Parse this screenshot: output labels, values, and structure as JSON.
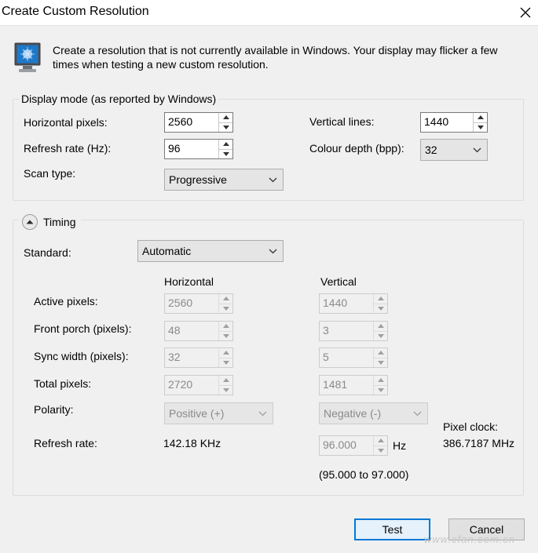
{
  "window": {
    "title": "Create Custom Resolution"
  },
  "intro": {
    "text": "Create a resolution that is not currently available in Windows. Your display may flicker a few times when testing a new custom resolution."
  },
  "display_mode": {
    "group_label": "Display mode (as reported by Windows)",
    "horizontal_pixels": {
      "label": "Horizontal pixels:",
      "value": "2560"
    },
    "vertical_lines": {
      "label": "Vertical lines:",
      "value": "1440"
    },
    "refresh_rate": {
      "label": "Refresh rate (Hz):",
      "value": "96"
    },
    "colour_depth": {
      "label": "Colour depth (bpp):",
      "value": "32"
    },
    "scan_type": {
      "label": "Scan type:",
      "value": "Progressive"
    }
  },
  "timing": {
    "label": "Timing",
    "standard": {
      "label": "Standard:",
      "value": "Automatic"
    },
    "col_horizontal": "Horizontal",
    "col_vertical": "Vertical",
    "rows": [
      {
        "label": "Active pixels:",
        "h": "2560",
        "v": "1440"
      },
      {
        "label": "Front porch (pixels):",
        "h": "48",
        "v": "3"
      },
      {
        "label": "Sync width (pixels):",
        "h": "32",
        "v": "5"
      },
      {
        "label": "Total pixels:",
        "h": "2720",
        "v": "1481"
      }
    ],
    "polarity": {
      "label": "Polarity:",
      "h": "Positive (+)",
      "v": "Negative (-)"
    },
    "refresh": {
      "label": "Refresh rate:",
      "h_value": "142.18 KHz",
      "v_value": "96.000",
      "unit": "Hz",
      "range": "(95.000 to 97.000)"
    },
    "pixel_clock": {
      "label": "Pixel clock:",
      "value": "386.7187 MHz"
    }
  },
  "buttons": {
    "test": "Test",
    "cancel": "Cancel"
  },
  "watermark": "www.cfan.com.cn",
  "icons": [
    "monitor-icon",
    "close-icon",
    "collapse-up-icon",
    "chevron-down-icon",
    "spin-up-icon",
    "spin-down-icon"
  ]
}
